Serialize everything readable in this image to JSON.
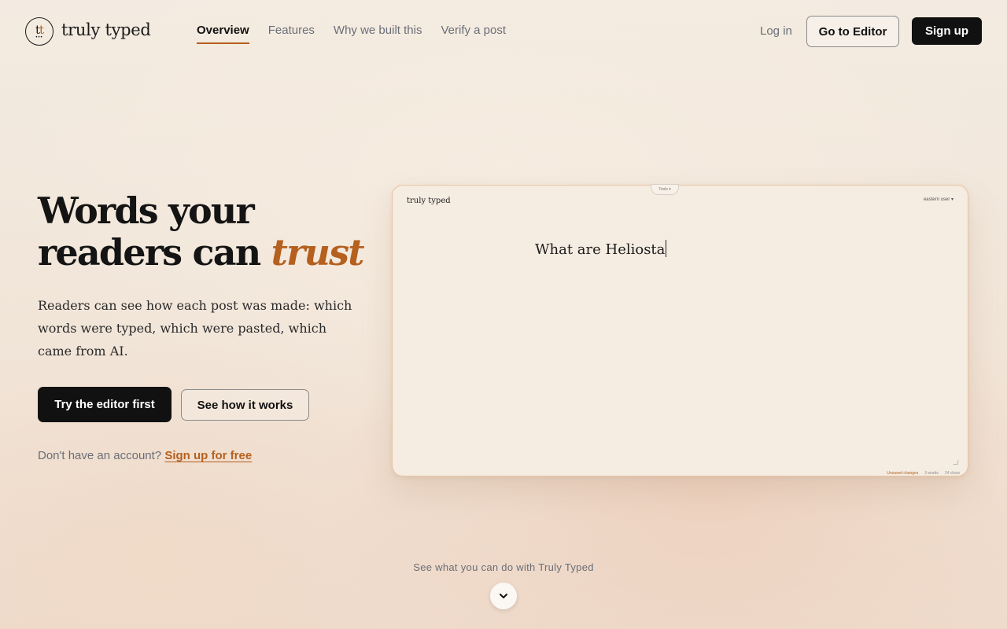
{
  "brand": {
    "name": "truly typed",
    "mark": "tt"
  },
  "nav": {
    "items": [
      {
        "label": "Overview",
        "active": true
      },
      {
        "label": "Features",
        "active": false
      },
      {
        "label": "Why we built this",
        "active": false
      },
      {
        "label": "Verify a post",
        "active": false
      }
    ]
  },
  "header": {
    "login": "Log in",
    "editor_button": "Go to Editor",
    "signup_button": "Sign up"
  },
  "hero": {
    "title_line1": "Words your",
    "title_line2": "readers can",
    "title_accent": "trust",
    "subtitle": "Readers can see how each post was made: which words were typed, which were pasted, which came from AI.",
    "primary_cta": "Try the editor first",
    "secondary_cta": "See how it works",
    "account_prompt": "Don't have an account?",
    "account_link": "Sign up for free"
  },
  "editor_preview": {
    "brand": "truly typed",
    "tools_label": "Tools ▾",
    "user_label": "eastern user ▾",
    "typed_text": "What are Heliosta",
    "status": {
      "unsaved": "Unsaved changes",
      "words": "3 words",
      "chars": "24 chars"
    }
  },
  "footer": {
    "see_more": "See what you can do with Truly Typed"
  },
  "colors": {
    "accent": "#b5601e",
    "dark": "#111111",
    "muted": "#6a6e78",
    "editor_border": "#e8c4a4"
  }
}
